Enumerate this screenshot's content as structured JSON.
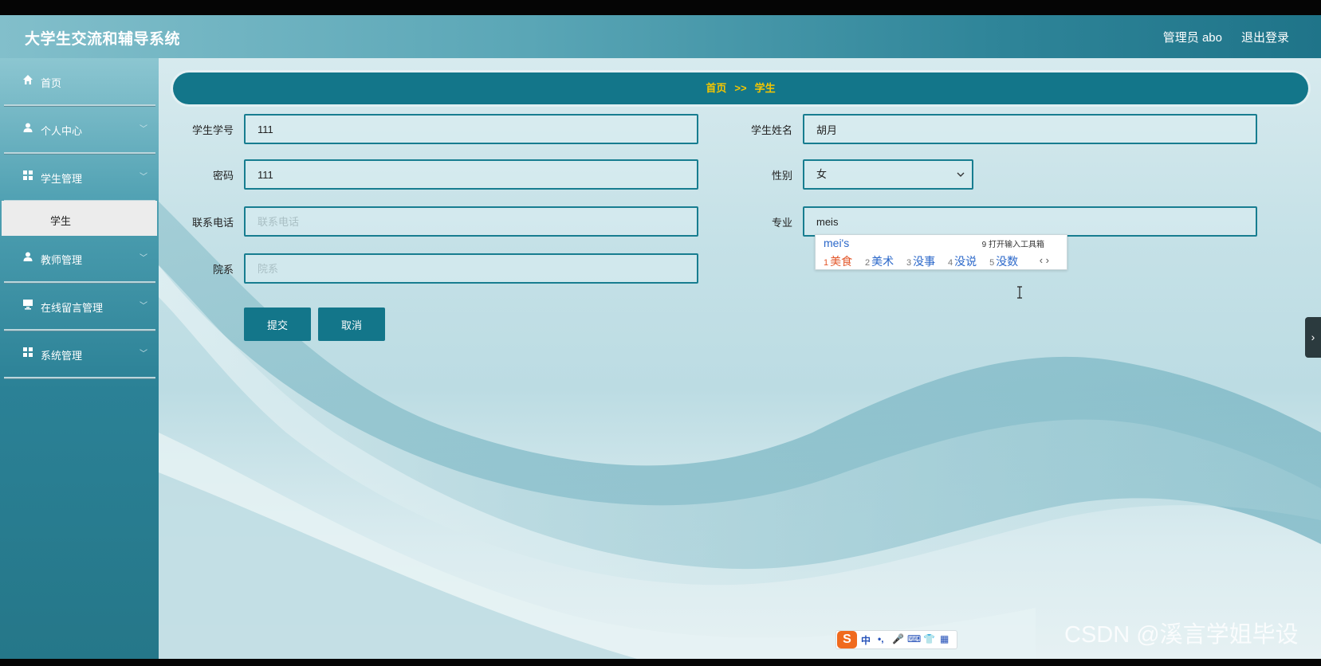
{
  "header": {
    "app_title": "大学生交流和辅导系统",
    "user_label": "管理员 abo",
    "logout_label": "退出登录"
  },
  "sidebar": {
    "items": [
      {
        "label": "首页",
        "icon": "home-icon"
      },
      {
        "label": "个人中心",
        "icon": "user-icon"
      },
      {
        "label": "学生管理",
        "icon": "grid-icon"
      },
      {
        "label": "教师管理",
        "icon": "user-icon"
      },
      {
        "label": "在线留言管理",
        "icon": "monitor-icon"
      },
      {
        "label": "系统管理",
        "icon": "grid-icon"
      }
    ],
    "active_submenu": "学生"
  },
  "breadcrumb": {
    "home": "首页",
    "separator": ">>",
    "current": "学生"
  },
  "form": {
    "student_id": {
      "label": "学生学号",
      "value": "111"
    },
    "student_name": {
      "label": "学生姓名",
      "value": "胡月"
    },
    "password": {
      "label": "密码",
      "value": "111"
    },
    "gender": {
      "label": "性别",
      "value": "女"
    },
    "phone": {
      "label": "联系电话",
      "value": "",
      "placeholder": "联系电话"
    },
    "major": {
      "label": "专业",
      "value": "meis"
    },
    "department": {
      "label": "院系",
      "value": "",
      "placeholder": "院系"
    },
    "submit_label": "提交",
    "cancel_label": "取消"
  },
  "ime": {
    "composition": "mei's",
    "toolbox_hint": "9 打开输入工具箱",
    "candidates": [
      {
        "n": "1",
        "text": "美食"
      },
      {
        "n": "2",
        "text": "美术"
      },
      {
        "n": "3",
        "text": "没事"
      },
      {
        "n": "4",
        "text": "没说"
      },
      {
        "n": "5",
        "text": "没数"
      }
    ],
    "toolbar": {
      "logo": "S",
      "mode": "中",
      "punct": "•,",
      "mic": "🎤",
      "keyboard": "⌨",
      "skin": "👕",
      "apps": "▦"
    }
  },
  "watermark": "CSDN @溪言学姐毕设",
  "colors": {
    "primary": "#13768a",
    "breadcrumb_text": "#f5c600",
    "ime_highlight": "#e3572a"
  }
}
